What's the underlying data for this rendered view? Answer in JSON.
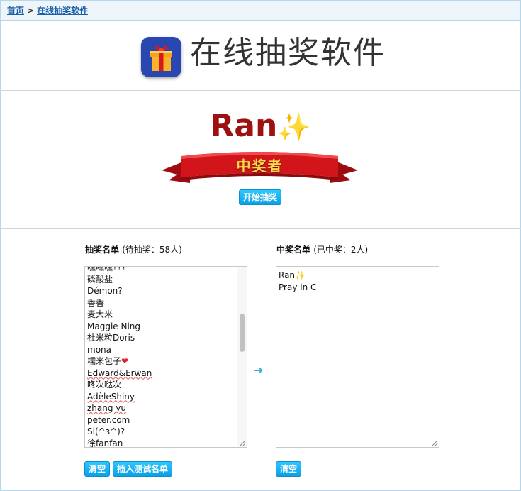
{
  "breadcrumb": {
    "home": "首页",
    "separator": ">",
    "current": "在线抽奖软件"
  },
  "header": {
    "title": "在线抽奖软件",
    "icon": "gift-box-icon"
  },
  "winner": {
    "name": "Ran",
    "emoji": "✨",
    "ribbon_label": "中奖者",
    "start_button": "开始抽奖"
  },
  "pool": {
    "label": "抽奖名单",
    "status": "(待抽奖：58人)",
    "items": [
      "嘿嘿嘿???",
      "磷酸盐",
      "Démon?",
      "香香",
      "麦大米",
      "Maggie Ning",
      "杜米粒Doris",
      "mona",
      "糯米包子",
      "Edward&Erwan",
      "咚次哒次",
      "AdèleShiny",
      "zhang yu",
      "peter.com",
      "Si(^з^)?",
      "徐fanfan"
    ],
    "clear_button": "清空",
    "test_button": "插入测试名单"
  },
  "winners_list": {
    "label": "中奖名单",
    "status": "(已中奖：2人)",
    "items": [
      "Ran✨",
      "Pray in C"
    ],
    "clear_button": "清空"
  },
  "colors": {
    "accent": "#0aa0e6",
    "winner_name": "#9e1111",
    "link": "#1a5fa8",
    "ribbon": "#c8141a"
  }
}
